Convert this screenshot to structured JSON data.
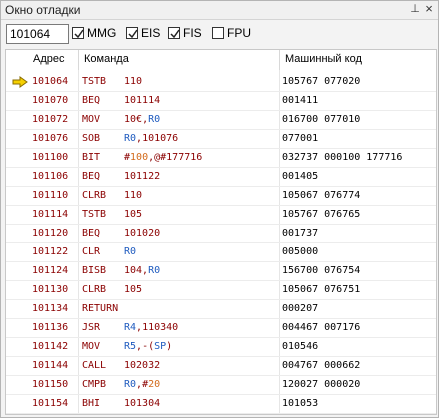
{
  "window": {
    "title": "Окно отладки",
    "pin_glyph": "⊥",
    "close_glyph": "×"
  },
  "toolbar": {
    "address_value": "101064",
    "checkboxes": [
      {
        "label": "MMG",
        "checked": true
      },
      {
        "label": "EIS",
        "checked": true
      },
      {
        "label": "FIS",
        "checked": true
      },
      {
        "label": "FPU",
        "checked": false
      }
    ]
  },
  "columns": {
    "address": "Адрес",
    "command": "Команда",
    "machine_code": "Машинный код"
  },
  "current_row_index": 0,
  "rows": [
    {
      "addr": "101064",
      "mn": "TSTB",
      "ops": [
        {
          "t": "110",
          "k": "p"
        }
      ],
      "code": "105767 077020"
    },
    {
      "addr": "101070",
      "mn": "BEQ",
      "ops": [
        {
          "t": "101114",
          "k": "p"
        }
      ],
      "code": "001411"
    },
    {
      "addr": "101072",
      "mn": "MOV",
      "ops": [
        {
          "t": "10",
          "k": "p"
        },
        {
          "t": "€",
          "k": "p"
        },
        {
          "t": ",",
          "k": "p"
        },
        {
          "t": "R0",
          "k": "r"
        }
      ],
      "code": "016700 077010"
    },
    {
      "addr": "101076",
      "mn": "SOB",
      "ops": [
        {
          "t": "R0",
          "k": "r"
        },
        {
          "t": ",101076",
          "k": "p"
        }
      ],
      "code": "077001"
    },
    {
      "addr": "101100",
      "mn": "BIT",
      "ops": [
        {
          "t": "#",
          "k": "p"
        },
        {
          "t": "100",
          "k": "i"
        },
        {
          "t": ",@#177716",
          "k": "p"
        }
      ],
      "code": "032737 000100 177716"
    },
    {
      "addr": "101106",
      "mn": "BEQ",
      "ops": [
        {
          "t": "101122",
          "k": "p"
        }
      ],
      "code": "001405"
    },
    {
      "addr": "101110",
      "mn": "CLRB",
      "ops": [
        {
          "t": "110",
          "k": "p"
        }
      ],
      "code": "105067 076774"
    },
    {
      "addr": "101114",
      "mn": "TSTB",
      "ops": [
        {
          "t": "105",
          "k": "p"
        }
      ],
      "code": "105767 076765"
    },
    {
      "addr": "101120",
      "mn": "BEQ",
      "ops": [
        {
          "t": "101020",
          "k": "p"
        }
      ],
      "code": "001737"
    },
    {
      "addr": "101122",
      "mn": "CLR",
      "ops": [
        {
          "t": "R0",
          "k": "r"
        }
      ],
      "code": "005000"
    },
    {
      "addr": "101124",
      "mn": "BISB",
      "ops": [
        {
          "t": "104,",
          "k": "p"
        },
        {
          "t": "R0",
          "k": "r"
        }
      ],
      "code": "156700 076754"
    },
    {
      "addr": "101130",
      "mn": "CLRB",
      "ops": [
        {
          "t": "105",
          "k": "p"
        }
      ],
      "code": "105067 076751"
    },
    {
      "addr": "101134",
      "mn": "RETURN",
      "ops": [],
      "code": "000207"
    },
    {
      "addr": "101136",
      "mn": "JSR",
      "ops": [
        {
          "t": "R4",
          "k": "r"
        },
        {
          "t": ",110340",
          "k": "p"
        }
      ],
      "code": "004467 007176"
    },
    {
      "addr": "101142",
      "mn": "MOV",
      "ops": [
        {
          "t": "R5",
          "k": "r"
        },
        {
          "t": ",-(",
          "k": "p"
        },
        {
          "t": "SP",
          "k": "r"
        },
        {
          "t": ")",
          "k": "p"
        }
      ],
      "code": "010546"
    },
    {
      "addr": "101144",
      "mn": "CALL",
      "ops": [
        {
          "t": "102032",
          "k": "p"
        }
      ],
      "code": "004767 000662"
    },
    {
      "addr": "101150",
      "mn": "CMPB",
      "ops": [
        {
          "t": "R0",
          "k": "r"
        },
        {
          "t": ",#",
          "k": "p"
        },
        {
          "t": "20",
          "k": "i"
        }
      ],
      "code": "120027 000020"
    },
    {
      "addr": "101154",
      "mn": "BHI",
      "ops": [
        {
          "t": "101304",
          "k": "p"
        }
      ],
      "code": "101053"
    }
  ],
  "colors": {
    "text_dark_red": "#8b0000",
    "register_blue": "#1f5bbf",
    "immediate_orange": "#d26a1b",
    "arrow_yellow": "#f5d000"
  },
  "icons": {
    "current_line": "yellow-arrow-icon",
    "pin": "pin-icon",
    "close": "close-icon"
  }
}
